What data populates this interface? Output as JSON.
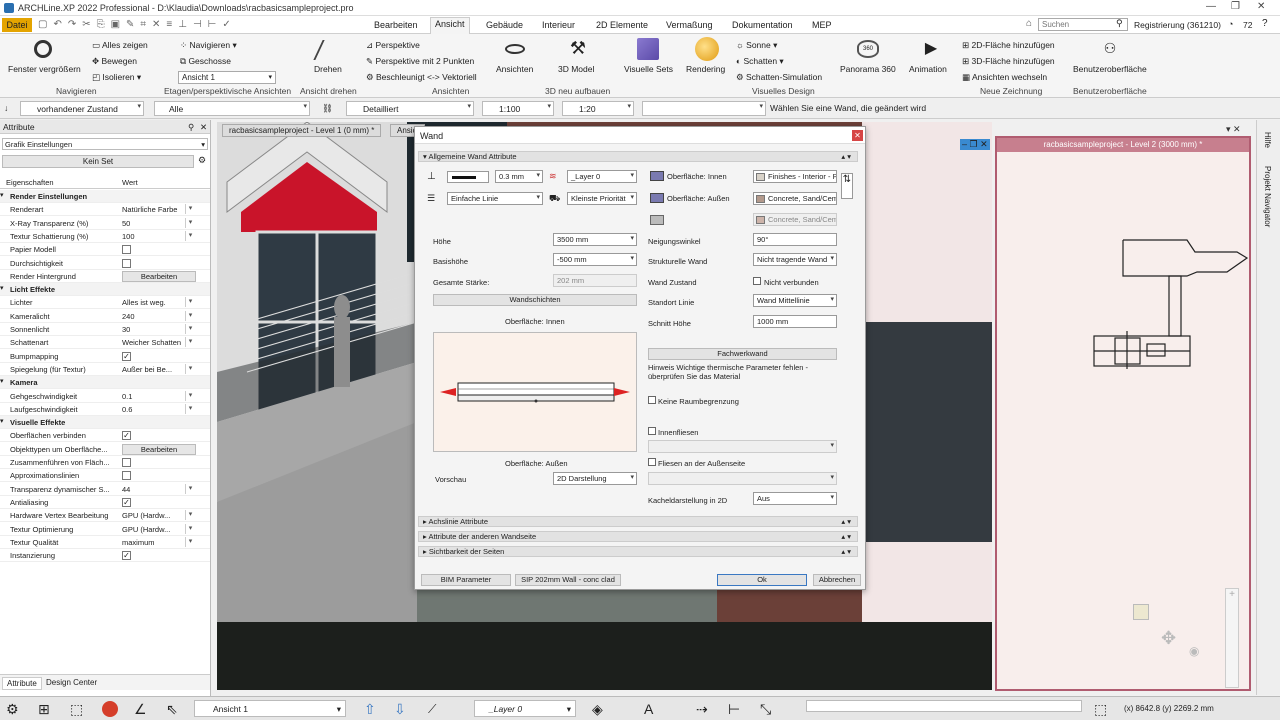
{
  "app": {
    "title": "ARCHLine.XP 2022 Professional - D:\\Klaudia\\Downloads\\racbasicsampleproject.pro",
    "file_menu": "Datei"
  },
  "ribbon_tabs": [
    "Bearbeiten",
    "Ansicht",
    "Gebäude",
    "Interieur",
    "2D Elemente",
    "Vermaßung",
    "Dokumentation",
    "MEP"
  ],
  "search": {
    "placeholder": "Suchen"
  },
  "account": {
    "label": "Registrierung (361210)",
    "count": "72"
  },
  "ribbon": {
    "navigieren": {
      "group": "Navigieren",
      "zoom": "Fenster vergrößern",
      "show_all": "Alles zeigen",
      "move": "Bewegen",
      "isolate": "Isolieren"
    },
    "etagen": {
      "group": "Etagen/perspektivische Ansichten",
      "navigate": "Navigieren",
      "floors": "Geschosse",
      "view": "Ansicht 1"
    },
    "drehen": {
      "group": "Ansicht drehen",
      "rotate": "Drehen"
    },
    "ansichten": {
      "group": "Ansichten",
      "persp": "Perspektive",
      "persp2": "Perspektive mit 2 Punkten",
      "accel": "Beschleunigt <-> Vektoriell",
      "views": "Ansichten"
    },
    "model3d": {
      "group": "3D neu aufbauen",
      "label": "3D Model"
    },
    "visuell": {
      "group": "Visuelles Design",
      "sets": "Visuelle Sets",
      "render": "Rendering",
      "sun": "Sonne",
      "shadow": "Schatten",
      "shadow_sim": "Schatten-Simulation",
      "pano": "Panorama 360",
      "anim": "Animation"
    },
    "zeichnung": {
      "group": "Neue Zeichnung",
      "add2d": "2D-Fläche hinzufügen",
      "add3d": "3D-Fläche hinzufügen",
      "switch": "Ansichten wechseln"
    },
    "ui": {
      "group": "Benutzeroberfläche",
      "label": "Benutzeroberfläche"
    }
  },
  "toolbar2": {
    "state": "vorhandener Zustand",
    "all": "Alle",
    "detail": "Detailliert",
    "scale1": "1:100",
    "scale2": "1:20",
    "hint": "Wählen Sie eine Wand, die geändert wird"
  },
  "attr_panel": {
    "title": "Attribute",
    "grafik": "Grafik Einstellungen",
    "set": "Kein Set",
    "col_prop": "Eigenschaften",
    "col_val": "Wert",
    "rows": [
      {
        "k": "Render Einstellungen",
        "type": "section"
      },
      {
        "k": "Renderart",
        "v": "Natürliche Farbe",
        "type": "dd"
      },
      {
        "k": "X-Ray Transparenz (%)",
        "v": "50",
        "type": "dd"
      },
      {
        "k": "Textur Schattierung (%)",
        "v": "100",
        "type": "dd"
      },
      {
        "k": "Papier Modell",
        "type": "chk",
        "checked": false
      },
      {
        "k": "Durchsichtigkeit",
        "type": "chk",
        "checked": false
      },
      {
        "k": "Render Hintergrund",
        "v": "Bearbeiten",
        "type": "btn"
      },
      {
        "k": "Licht Effekte",
        "type": "section"
      },
      {
        "k": "Lichter",
        "v": "Alles ist weg.",
        "type": "dd"
      },
      {
        "k": "Kameralicht",
        "v": "240",
        "type": "dd"
      },
      {
        "k": "Sonnenlicht",
        "v": "30",
        "type": "dd"
      },
      {
        "k": "Schattenart",
        "v": "Weicher Schatten",
        "type": "dd"
      },
      {
        "k": "Bumpmapping",
        "type": "chk",
        "checked": true
      },
      {
        "k": "Spiegelung (für Textur)",
        "v": "Außer bei Be...",
        "type": "dd"
      },
      {
        "k": "Kamera",
        "type": "section"
      },
      {
        "k": "Gehgeschwindigkeit",
        "v": "0.1",
        "type": "dd"
      },
      {
        "k": "Laufgeschwindigkeit",
        "v": "0.6",
        "type": "dd"
      },
      {
        "k": "Visuelle Effekte",
        "type": "section"
      },
      {
        "k": "Oberflächen verbinden",
        "type": "chk",
        "checked": true
      },
      {
        "k": "Objekttypen um Oberfläche...",
        "v": "Bearbeiten",
        "type": "btn"
      },
      {
        "k": "Zusammenführen von Fläch...",
        "type": "chk",
        "checked": false
      },
      {
        "k": "Approximationslinien",
        "type": "chk",
        "checked": false
      },
      {
        "k": "Transparenz dynamischer S...",
        "v": "44",
        "type": "dd"
      },
      {
        "k": "Antialiasing",
        "type": "chk",
        "checked": true
      },
      {
        "k": "Hardware Vertex Bearbeitung",
        "v": "GPU (Hardw...",
        "type": "dd"
      },
      {
        "k": "Textur Optimierung",
        "v": "GPU (Hardw...",
        "type": "dd"
      },
      {
        "k": "Textur Qualität",
        "v": "maximum",
        "type": "dd"
      },
      {
        "k": "Instanzierung",
        "type": "chk",
        "checked": true
      }
    ],
    "tabs": [
      "Attribute",
      "Design Center"
    ]
  },
  "view_tabs": {
    "left": "racbasicsampleproject - Level 1 (0 mm) *",
    "left2": "Ansicl",
    "right": "racbasicsampleproject - Level 2 (3000 mm) *"
  },
  "side_labels": {
    "help": "Hilfe",
    "navigator": "Projekt Navigator"
  },
  "dialog": {
    "title": "Wand",
    "sections": {
      "general": "Allgemeine Wand Attribute",
      "axis": "Achslinie Attribute",
      "other_side": "Attribute der anderen Wandseite",
      "visibility": "Sichtbarkeit der Seiten"
    },
    "pen_width": "0.3 mm",
    "layer": "_Layer 0",
    "line_type": "Einfache Linie",
    "priority": "Kleinste Priorität",
    "surface_in": "Oberfläche: Innen",
    "surface_out": "Oberfläche: Außen",
    "mat_in": "Finishes - Interior - Pla",
    "mat_out": "Concrete, Sand/Ceme",
    "mat_3": "Concrete, Sand/Ceme",
    "height_label": "Höhe",
    "height": "3500 mm",
    "base_label": "Basishöhe",
    "base": "-500 mm",
    "thick_label": "Gesamte Stärke:",
    "thick": "202 mm",
    "layers_btn": "Wandschichten",
    "preview_top": "Oberfläche: Innen",
    "preview_bottom": "Oberfläche: Außen",
    "preview_label": "Vorschau",
    "preview_mode": "2D Darstellung",
    "incline_label": "Neigungswinkel",
    "incline": "90°",
    "struct_label": "Strukturelle Wand",
    "struct": "Nicht tragende Wand",
    "state_label": "Wand Zustand",
    "not_connected": "Nicht verbunden",
    "loc_label": "Standort Linie",
    "loc": "Wand Mittellinie",
    "cut_label": "Schnitt Höhe",
    "cut": "1000 mm",
    "expert_btn": "Fachwerkwand",
    "hint": "Hinweis Wichtige thermische Parameter fehlen - überprüfen Sie das Material",
    "no_room": "Keine Raumbegrenzung",
    "tiles_in": "Innenfliesen",
    "tiles_out": "Fliesen an der Außenseite",
    "tile_2d_label": "Kacheldarstellung in 2D",
    "tile_2d": "Aus",
    "bim_btn": "BIM Parameter",
    "type_btn": "SIP 202mm Wall - conc clad",
    "ok": "Ok",
    "cancel": "Abbrechen"
  },
  "status": {
    "view": "Ansicht 1",
    "layer": "_Layer 0",
    "coords": "(x) 8642.8  (y) 2269.2 mm"
  }
}
